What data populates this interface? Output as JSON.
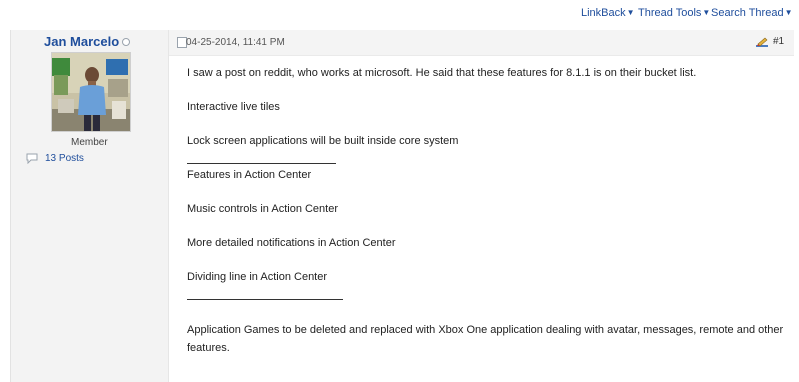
{
  "toolbar": {
    "linkback": "LinkBack",
    "thread_tools": "Thread Tools",
    "search_thread": "Search Thread"
  },
  "user": {
    "name": "Jan Marcelo",
    "title": "Member",
    "posts": "13 Posts"
  },
  "post": {
    "date": "04-25-2014, 11:41 PM",
    "number": "#1",
    "lines": {
      "intro": "I saw a post on reddit, who works at microsoft. He said that these features for 8.1.1 is on their bucket list.",
      "l1": "Interactive live tiles",
      "l2": "Lock screen applications will be built inside core system",
      "l3": "Features in Action Center",
      "l4": "Music controls in Action Center",
      "l5": "More detailed notifications in Action Center",
      "l6": "Dividing line in Action Center",
      "l7": "Application Games to be deleted and replaced with Xbox One application dealing with avatar, messages, remote and other features."
    }
  },
  "colors": {
    "link": "#1f4e9c",
    "panel": "#f3f3f3",
    "body": "#ffffff"
  }
}
